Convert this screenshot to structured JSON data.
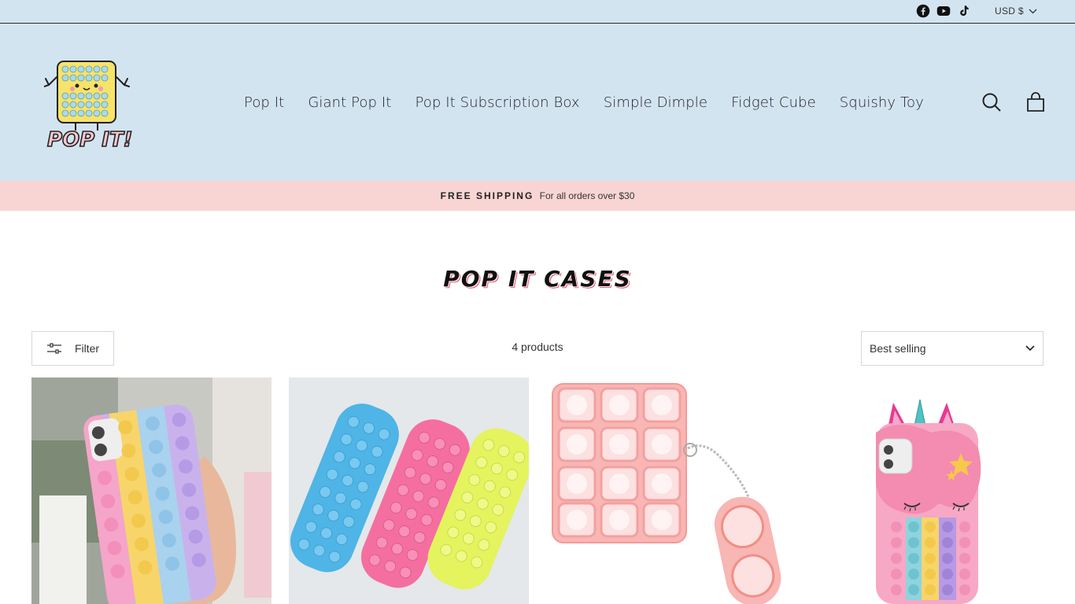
{
  "topbar": {
    "social": [
      {
        "name": "facebook-icon",
        "color": "#111111"
      },
      {
        "name": "youtube-icon",
        "color": "#111111"
      },
      {
        "name": "tiktok-icon",
        "color": "#111111"
      }
    ],
    "currency": "USD $"
  },
  "header": {
    "logo_alt": "POP IT!",
    "nav": [
      "Pop It",
      "Giant Pop It",
      "Pop It Subscription Box",
      "Simple Dimple",
      "Fidget Cube",
      "Squishy Toy"
    ],
    "icons": [
      "search-icon",
      "cart-icon"
    ]
  },
  "announcement": {
    "bold": "FREE SHIPPING",
    "text": "For all orders over $30"
  },
  "collection": {
    "title": "POP IT CASES",
    "filter_label": "Filter",
    "product_count": "4 products",
    "sort_value": "Best selling"
  },
  "products": [
    {
      "image": "rainbow-pop-it-phone-case-in-hand"
    },
    {
      "image": "pop-it-pencil-cases-blue-pink-yellow"
    },
    {
      "image": "pink-pop-it-airpods-case-with-keychain"
    },
    {
      "image": "unicorn-pop-it-phone-case"
    }
  ],
  "colors": {
    "header_bg": "#d3e4f1",
    "announce_bg": "#f8d5d3",
    "accent_pink": "#e85a7a"
  }
}
